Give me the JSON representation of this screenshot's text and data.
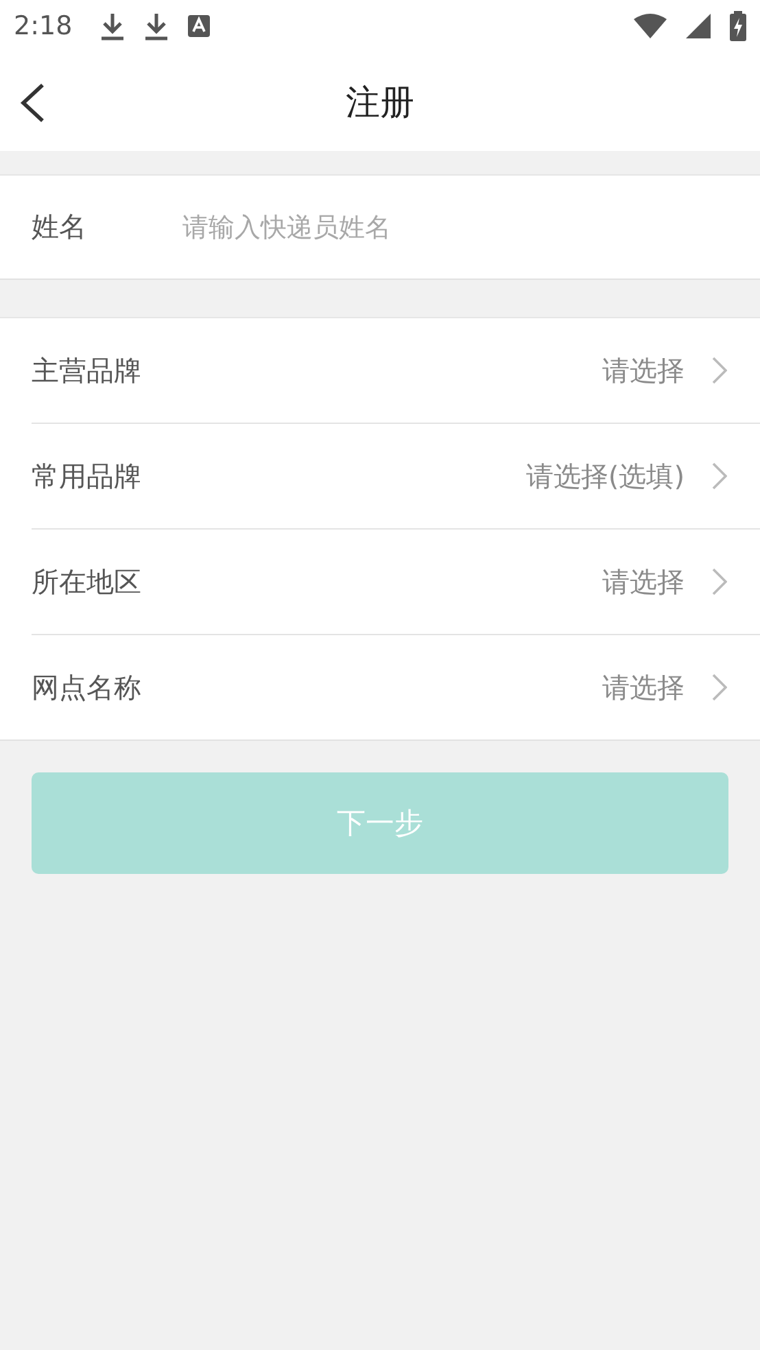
{
  "status_bar": {
    "time": "2:18"
  },
  "header": {
    "title": "注册"
  },
  "name_field": {
    "label": "姓名",
    "placeholder": "请输入快递员姓名"
  },
  "rows": [
    {
      "label": "主营品牌",
      "value": "请选择"
    },
    {
      "label": "常用品牌",
      "value": "请选择(选填)"
    },
    {
      "label": "所在地区",
      "value": "请选择"
    },
    {
      "label": "网点名称",
      "value": "请选择"
    }
  ],
  "next_button": {
    "label": "下一步",
    "disabled": true
  }
}
